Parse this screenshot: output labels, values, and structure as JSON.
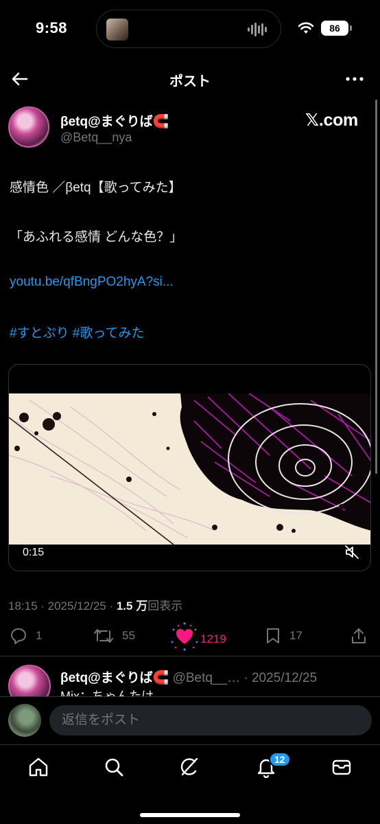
{
  "status": {
    "time": "9:58",
    "battery": "86"
  },
  "nav": {
    "title": "ポスト"
  },
  "post": {
    "author_name": "βetq@まぐりば🧲",
    "author_handle": "@Betq__nya",
    "watermark": "𝕏.com",
    "lines": [
      "感情色 ／βetq【歌ってみた】",
      "「あふれる感情 どんな色？」"
    ],
    "link": "youtu.be/qfBngPO2hyA?si...",
    "hashtags": "#すとぷり #歌ってみた",
    "video_time": "0:15",
    "meta_prefix": "18:15 · 2025/12/25 · ",
    "views": "1.5 万",
    "views_suffix": "回表示"
  },
  "actions": {
    "replies": "1",
    "reposts": "55",
    "likes": "1219",
    "bookmarks": "17"
  },
  "reply": {
    "author_name": "βetq@まぐりば🧲",
    "author_handle": "@Betq__… · 2025/12/25",
    "text": "Mix：ちゃんたけ"
  },
  "composer": {
    "placeholder": "返信をポスト"
  },
  "tabs": {
    "notifications_badge": "12"
  },
  "colors": {
    "accent": "#1d9bf0",
    "like": "#f91880",
    "muted": "#71767b"
  }
}
